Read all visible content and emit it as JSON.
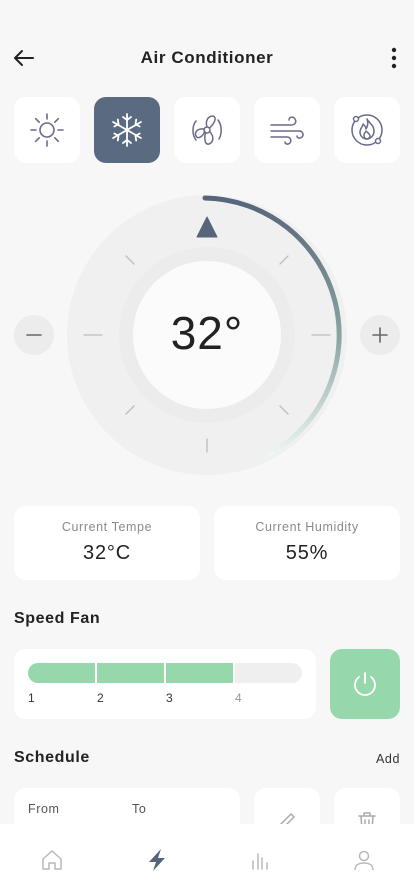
{
  "header": {
    "title": "Air Conditioner"
  },
  "modes": [
    {
      "name": "sun-icon",
      "active": false
    },
    {
      "name": "snowflake-icon",
      "active": true
    },
    {
      "name": "fan-icon",
      "active": false
    },
    {
      "name": "wind-icon",
      "active": false
    },
    {
      "name": "flame-icon",
      "active": false
    }
  ],
  "dial": {
    "temperature": "32°",
    "level_fraction": 0.62
  },
  "stats": {
    "temperature": {
      "label": "Current Tempe",
      "value": "32°C"
    },
    "humidity": {
      "label": "Current Humidity",
      "value": "55%"
    }
  },
  "speed_fan": {
    "title": "Speed Fan",
    "levels": [
      "1",
      "2",
      "3",
      "4"
    ],
    "current_level": 3
  },
  "schedule": {
    "title": "Schedule",
    "add_label": "Add",
    "from_label": "From",
    "to_label": "To"
  },
  "nav": [
    "home-icon",
    "bolt-icon",
    "stats-icon",
    "profile-icon"
  ],
  "colors": {
    "accent": "#5a6a80",
    "green": "#96d8ab",
    "background": "#f7f7f7"
  }
}
